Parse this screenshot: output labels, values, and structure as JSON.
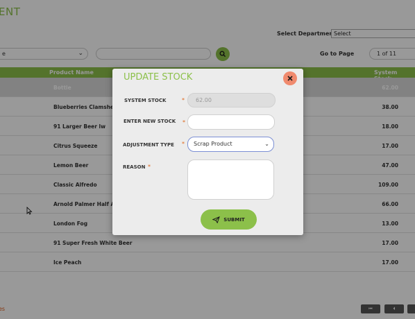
{
  "page": {
    "title": "ENT",
    "department_label": "Select Department:",
    "department_value": "Select",
    "filter_value": "e",
    "search_value": "",
    "goto_label": "Go to Page",
    "goto_value": "1 of 11",
    "footer_text": "es"
  },
  "table": {
    "headers": {
      "product": "Product Name",
      "stock": "System Stock"
    },
    "rows": [
      {
        "name": "Bottle",
        "stock": "62.00"
      },
      {
        "name": "Blueberries Clamshell",
        "stock": "38.00"
      },
      {
        "name": "91 Larger Beer lw",
        "stock": "18.00"
      },
      {
        "name": "Citrus Squeeze",
        "stock": "17.00"
      },
      {
        "name": "Lemon Beer",
        "stock": "47.00"
      },
      {
        "name": "Classic Alfredo",
        "stock": "109.00"
      },
      {
        "name": "Arnold Palmer Half And",
        "stock": "66.00"
      },
      {
        "name": "London Fog",
        "stock": "13.00"
      },
      {
        "name": "91 Super Fresh White Beer",
        "stock": "17.00"
      },
      {
        "name": "Ice Peach",
        "stock": "17.00"
      }
    ]
  },
  "pager": {
    "first": "⏮",
    "prev": "⏴"
  },
  "modal": {
    "title": "UPDATE STOCK",
    "system_stock_label": "SYSTEM STOCK",
    "system_stock_value": "62.00",
    "new_stock_label": "ENTER NEW STOCK",
    "new_stock_value": "",
    "adjustment_label": "ADJUSTMENT TYPE",
    "adjustment_value": "Scrap Product",
    "reason_label": "REASON",
    "reason_value": "",
    "required_mark": "*",
    "submit_label": "SUBMIT"
  },
  "icons": {
    "search": "search-icon",
    "close": "close-icon",
    "send": "send-icon",
    "chevron": "chevron-down-icon"
  },
  "colors": {
    "accent": "#8cc04a",
    "close": "#f08a6e",
    "required": "#e0661a",
    "select_border": "#7b8fd4"
  }
}
